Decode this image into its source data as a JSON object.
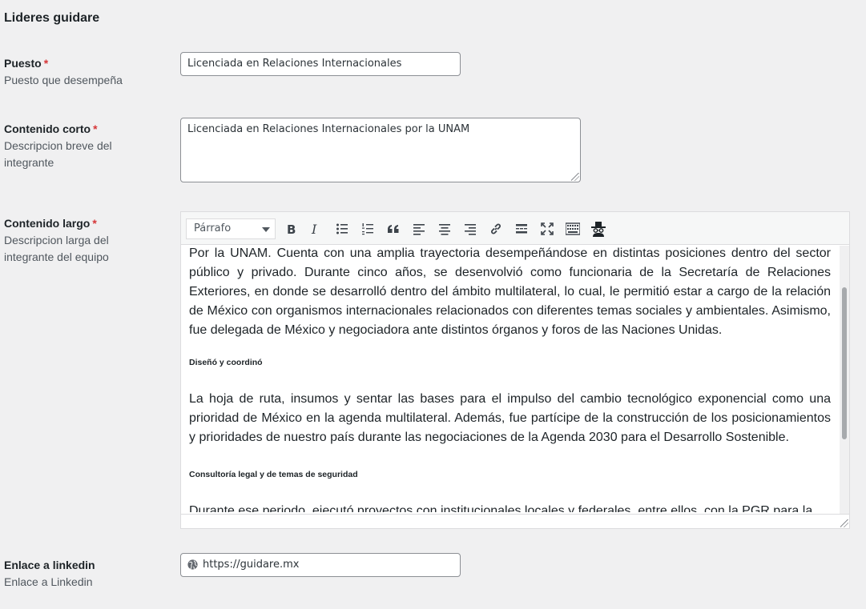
{
  "section": {
    "title": "Lideres guidare"
  },
  "required_mark": "*",
  "fields": {
    "puesto": {
      "label": "Puesto",
      "description": "Puesto que desempeña",
      "value": "Licenciada en Relaciones Internacionales"
    },
    "contenido_corto": {
      "label": "Contenido corto",
      "description": "Descripcion breve del integrante",
      "value": "Licenciada en Relaciones Internacionales por la UNAM"
    },
    "contenido_largo": {
      "label": "Contenido largo",
      "description": "Descripcion larga del integrante del equipo",
      "toolbar": {
        "format_select": "Párrafo",
        "buttons": [
          "bold-icon",
          "italic-icon",
          "bullet-list-icon",
          "numbered-list-icon",
          "blockquote-icon",
          "align-left-icon",
          "align-center-icon",
          "align-right-icon",
          "link-icon",
          "read-more-icon",
          "fullscreen-icon",
          "toolbar-toggle-icon",
          "incognito-icon"
        ]
      },
      "content": {
        "p1": "Por la UNAM. Cuenta con una amplia trayectoria desempeñándose en distintas posiciones dentro del sector público y privado. Durante cinco años, se desenvolvió como funcionaria de la Secretaría de Relaciones Exteriores, en donde se desarrolló dentro del ámbito multilateral, lo cual, le permitió estar a cargo de la relación de México con organismos internacionales relacionados con diferentes temas sociales y ambientales. Asimismo, fue delegada de México y negociadora ante distintos órganos y foros de las Naciones Unidas.",
        "h1": "Diseñó y coordinó",
        "p2": "La hoja de ruta, insumos y sentar las bases para el impulso del cambio tecnológico exponencial como una prioridad de México en la agenda multilateral. Además, fue partícipe de la construcción de los posicionamientos y prioridades de nuestro país durante las negociaciones de la Agenda 2030 para el Desarrollo Sostenible.",
        "h2": "Consultoría legal y de temas de seguridad",
        "p3": "Durante ese periodo, ejecutó proyectos con institucionales locales y federales, entre ellos, con la PGR para la"
      }
    },
    "linkedin": {
      "label": "Enlace a linkedin",
      "description": "Enlace a Linkedin",
      "value": "https://guidare.mx"
    }
  },
  "colors": {
    "background": "#f0f0f1",
    "required": "#d63638",
    "border": "#8c8f94"
  }
}
